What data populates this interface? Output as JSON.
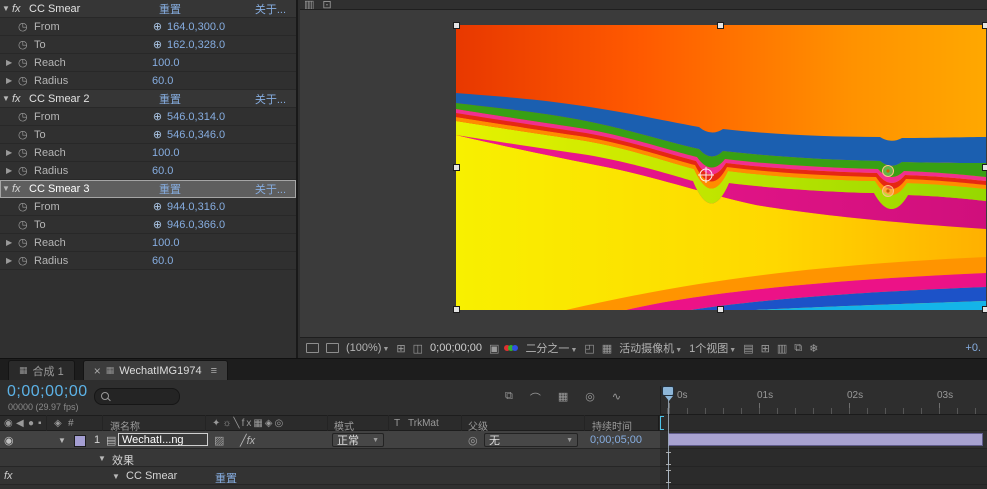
{
  "icons": {
    "collapse": "▼",
    "expand": "▶",
    "stopwatch": "◷",
    "point_picker": "⊕",
    "fx": "fx",
    "close": "×",
    "panel_menu": "≡",
    "dropdown": "▼",
    "eye": "◉",
    "audio": "◀",
    "solo": "●",
    "lock": "▪",
    "label_col": "◈",
    "hash": "#",
    "doc": "▤",
    "parent_pick": "◎",
    "tab": "▦",
    "grid": "⊞",
    "mask": "◫",
    "camera_snap": "▣",
    "roi": "◰",
    "checker": "▦",
    "disp1": "▥",
    "disp2": "⊡",
    "m1": "▤",
    "m2": "⊞",
    "m3": "❄",
    "h1": "⧉",
    "h2": "⌒",
    "h3": "▦",
    "h4": "◎",
    "h5": "∿",
    "switches": "✦☼╲fx▦◈◎",
    "quality": "▨",
    "slash_fx": "╱fx"
  },
  "effects_panel": {
    "reset_label": "重置",
    "about_label": "关于...",
    "labels": {
      "from": "From",
      "to": "To",
      "reach": "Reach",
      "radius": "Radius"
    },
    "effects": [
      {
        "name": "CC Smear",
        "from": "164.0,300.0",
        "to": "162.0,328.0",
        "reach": "100.0",
        "radius": "60.0"
      },
      {
        "name": "CC Smear 2",
        "from": "546.0,314.0",
        "to": "546.0,346.0",
        "reach": "100.0",
        "radius": "60.0"
      },
      {
        "name": "CC Smear 3",
        "from": "944.0,316.0",
        "to": "946.0,366.0",
        "reach": "100.0",
        "radius": "60.0"
      }
    ]
  },
  "viewer": {
    "zoom": "(100%)",
    "timecode": "0;00;00;00",
    "resolution": "二分之一",
    "camera": "活动摄像机",
    "views": "1个视图",
    "exposure": "+0."
  },
  "tabs": {
    "composition": "合成 1",
    "timeline": "WechatIMG1974"
  },
  "timeline": {
    "timecode": "0;00;00;00",
    "frame_info": "00000 (29.97 fps)",
    "ruler": [
      "0s",
      "01s",
      "02s",
      "03s"
    ],
    "columns": {
      "source_name": "源名称",
      "mode": "模式",
      "t": "T",
      "trkmat": "TrkMat",
      "parent": "父级",
      "duration": "持续时间"
    },
    "layer": {
      "index": "1",
      "name": "WechatI...ng",
      "mode": "正常",
      "parent": "无",
      "duration": "0;00;05;00"
    },
    "effects_group": "效果",
    "effect_name": "CC Smear",
    "reset": "重置",
    "fx_badge": "fx"
  }
}
